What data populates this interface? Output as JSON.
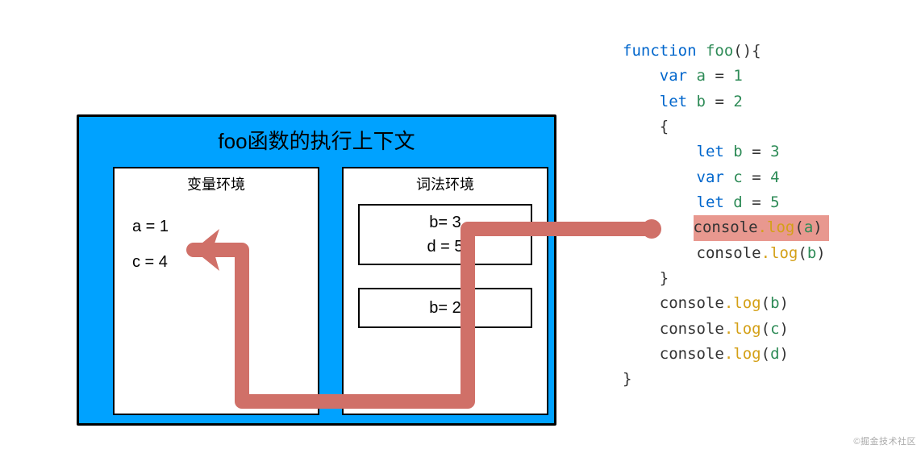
{
  "context": {
    "title": "foo函数的执行上下文",
    "variable_env": {
      "title": "变量环境",
      "entries": [
        "a = 1",
        "c = 4"
      ]
    },
    "lexical_env": {
      "title": "词法环境",
      "inner_block": {
        "line1": "b= 3",
        "line2": "d = 5"
      },
      "outer_block": {
        "line1": "b= 2"
      }
    }
  },
  "code": {
    "lines": [
      {
        "indent": 0,
        "tokens": [
          {
            "cls": "kw",
            "t": "function"
          },
          {
            "cls": "",
            "t": " "
          },
          {
            "cls": "fn",
            "t": "foo"
          },
          {
            "cls": "",
            "t": "(){"
          }
        ]
      },
      {
        "indent": 1,
        "tokens": [
          {
            "cls": "kw",
            "t": "var"
          },
          {
            "cls": "",
            "t": " "
          },
          {
            "cls": "fn",
            "t": "a"
          },
          {
            "cls": "",
            "t": " = "
          },
          {
            "cls": "num",
            "t": "1"
          }
        ]
      },
      {
        "indent": 1,
        "tokens": [
          {
            "cls": "kw",
            "t": "let"
          },
          {
            "cls": "",
            "t": " "
          },
          {
            "cls": "fn",
            "t": "b"
          },
          {
            "cls": "",
            "t": " = "
          },
          {
            "cls": "num",
            "t": "2"
          }
        ]
      },
      {
        "indent": 1,
        "tokens": [
          {
            "cls": "",
            "t": "{"
          }
        ]
      },
      {
        "indent": 2,
        "tokens": [
          {
            "cls": "kw",
            "t": "let"
          },
          {
            "cls": "",
            "t": " "
          },
          {
            "cls": "fn",
            "t": "b"
          },
          {
            "cls": "",
            "t": " = "
          },
          {
            "cls": "num",
            "t": "3"
          }
        ]
      },
      {
        "indent": 2,
        "tokens": [
          {
            "cls": "kw",
            "t": "var"
          },
          {
            "cls": "",
            "t": " "
          },
          {
            "cls": "fn",
            "t": "c"
          },
          {
            "cls": "",
            "t": " = "
          },
          {
            "cls": "num",
            "t": "4"
          }
        ]
      },
      {
        "indent": 2,
        "tokens": [
          {
            "cls": "kw",
            "t": "let"
          },
          {
            "cls": "",
            "t": " "
          },
          {
            "cls": "fn",
            "t": "d"
          },
          {
            "cls": "",
            "t": " = "
          },
          {
            "cls": "num",
            "t": "5"
          }
        ]
      },
      {
        "indent": 2,
        "hl": true,
        "tokens": [
          {
            "cls": "gl",
            "t": "console"
          },
          {
            "cls": "mtd",
            "t": "."
          },
          {
            "cls": "mtd",
            "t": "log"
          },
          {
            "cls": "",
            "t": "("
          },
          {
            "cls": "fn",
            "t": "a"
          },
          {
            "cls": "",
            "t": ")"
          }
        ]
      },
      {
        "indent": 2,
        "tokens": [
          {
            "cls": "gl",
            "t": "console"
          },
          {
            "cls": "mtd",
            "t": "."
          },
          {
            "cls": "mtd",
            "t": "log"
          },
          {
            "cls": "",
            "t": "("
          },
          {
            "cls": "fn",
            "t": "b"
          },
          {
            "cls": "",
            "t": ")"
          }
        ]
      },
      {
        "indent": 1,
        "tokens": [
          {
            "cls": "",
            "t": "}"
          }
        ]
      },
      {
        "indent": 1,
        "tokens": [
          {
            "cls": "gl",
            "t": "console"
          },
          {
            "cls": "mtd",
            "t": "."
          },
          {
            "cls": "mtd",
            "t": "log"
          },
          {
            "cls": "",
            "t": "("
          },
          {
            "cls": "fn",
            "t": "b"
          },
          {
            "cls": "",
            "t": ")"
          }
        ]
      },
      {
        "indent": 1,
        "tokens": [
          {
            "cls": "gl",
            "t": "console"
          },
          {
            "cls": "mtd",
            "t": "."
          },
          {
            "cls": "mtd",
            "t": "log"
          },
          {
            "cls": "",
            "t": "("
          },
          {
            "cls": "fn",
            "t": "c"
          },
          {
            "cls": "",
            "t": ")"
          }
        ]
      },
      {
        "indent": 1,
        "tokens": [
          {
            "cls": "gl",
            "t": "console"
          },
          {
            "cls": "mtd",
            "t": "."
          },
          {
            "cls": "mtd",
            "t": "log"
          },
          {
            "cls": "",
            "t": "("
          },
          {
            "cls": "fn",
            "t": "d"
          },
          {
            "cls": "",
            "t": ")"
          }
        ]
      },
      {
        "indent": 0,
        "tokens": [
          {
            "cls": "",
            "t": "}"
          }
        ]
      }
    ]
  },
  "watermark": "©掘金技术社区"
}
